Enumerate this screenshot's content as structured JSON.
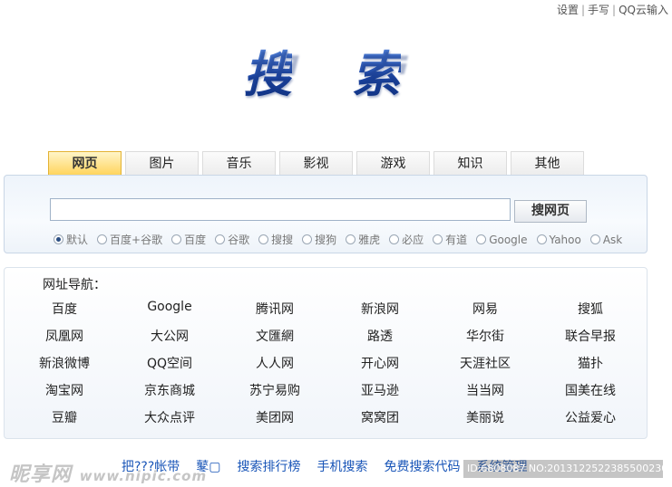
{
  "toplinks": [
    "设置",
    "手写",
    "QQ云输入"
  ],
  "logo": {
    "char1": "搜",
    "char2": "索"
  },
  "tabs": [
    {
      "label": "网页",
      "active": true
    },
    {
      "label": "图片"
    },
    {
      "label": "音乐"
    },
    {
      "label": "影视"
    },
    {
      "label": "游戏"
    },
    {
      "label": "知识"
    },
    {
      "label": "其他"
    }
  ],
  "search": {
    "value": "",
    "button": "搜网页"
  },
  "engines": [
    {
      "label": "默认",
      "selected": true
    },
    {
      "label": "百度+谷歌"
    },
    {
      "label": "百度"
    },
    {
      "label": "谷歌"
    },
    {
      "label": "搜搜"
    },
    {
      "label": "搜狗"
    },
    {
      "label": "雅虎"
    },
    {
      "label": "必应"
    },
    {
      "label": "有道"
    },
    {
      "label": "Google"
    },
    {
      "label": "Yahoo"
    },
    {
      "label": "Ask"
    }
  ],
  "nav": {
    "title": "网址导航：",
    "links": [
      "百度",
      "Google",
      "腾讯网",
      "新浪网",
      "网易",
      "搜狐",
      "凤凰网",
      "大公网",
      "文匯網",
      "路透",
      "华尔街",
      "联合早报",
      "新浪微博",
      "QQ空间",
      "人人网",
      "开心网",
      "天涯社区",
      "猫扑",
      "淘宝网",
      "京东商城",
      "苏宁易购",
      "亚马逊",
      "当当网",
      "国美在线",
      "豆瓣",
      "大众点评",
      "美团网",
      "窝窝团",
      "美丽说",
      "公益爱心"
    ]
  },
  "footer": [
    "把???帐带",
    "鼕▢",
    "搜索排行榜",
    "手机搜索",
    "免费搜索代码",
    "系统管理"
  ],
  "watermark": {
    "left_main": "昵享网",
    "left_url": "www.nipic.com",
    "right": "ID:6808087 NO:20131225223855002305"
  },
  "colors": {
    "tab_active": "#ffd35a",
    "link_blue": "#1a56b8",
    "logo_blue": "#1f4fa8"
  }
}
